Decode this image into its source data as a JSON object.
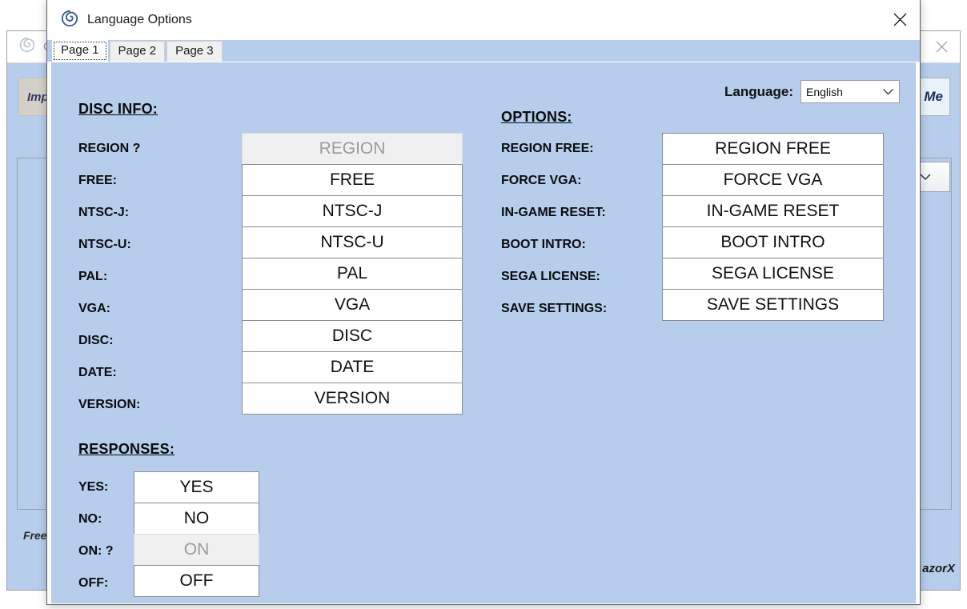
{
  "background_window": {
    "title": "G",
    "icon": "dreamcast-spiral-icon",
    "close_label": "✕",
    "import_button": "Imp",
    "me_button": "Me",
    "combo_chevron": "⌄",
    "footer_left": "Free",
    "footer_right": "azorX"
  },
  "dialog": {
    "title": "Language Options",
    "icon": "dreamcast-spiral-icon",
    "close_label": "✕",
    "tabs": [
      {
        "label": "Page 1",
        "active": true
      },
      {
        "label": "Page 2",
        "active": false
      },
      {
        "label": "Page 3",
        "active": false
      }
    ],
    "language": {
      "label": "Language:",
      "value": "English",
      "chevron": "⌄",
      "options": [
        "English"
      ]
    },
    "sections": {
      "disc_info": {
        "heading": "DISC INFO:",
        "rows": [
          {
            "label": "REGION ?",
            "value": "REGION",
            "disabled": true
          },
          {
            "label": "FREE:",
            "value": "FREE",
            "disabled": false
          },
          {
            "label": "NTSC-J:",
            "value": "NTSC-J",
            "disabled": false
          },
          {
            "label": "NTSC-U:",
            "value": "NTSC-U",
            "disabled": false
          },
          {
            "label": "PAL:",
            "value": "PAL",
            "disabled": false
          },
          {
            "label": "VGA:",
            "value": "VGA",
            "disabled": false
          },
          {
            "label": "DISC:",
            "value": "DISC",
            "disabled": false
          },
          {
            "label": "DATE:",
            "value": "DATE",
            "disabled": false
          },
          {
            "label": "VERSION:",
            "value": "VERSION",
            "disabled": false
          }
        ]
      },
      "options": {
        "heading": "OPTIONS:",
        "rows": [
          {
            "label": "REGION FREE:",
            "value": "REGION FREE",
            "disabled": false
          },
          {
            "label": "FORCE VGA:",
            "value": "FORCE VGA",
            "disabled": false
          },
          {
            "label": "IN-GAME RESET:",
            "value": "IN-GAME RESET",
            "disabled": false
          },
          {
            "label": "BOOT INTRO:",
            "value": "BOOT INTRO",
            "disabled": false
          },
          {
            "label": "SEGA LICENSE:",
            "value": "SEGA LICENSE",
            "disabled": false
          },
          {
            "label": "SAVE SETTINGS:",
            "value": "SAVE SETTINGS",
            "disabled": false
          }
        ]
      },
      "responses": {
        "heading": "RESPONSES:",
        "rows": [
          {
            "label": "YES:",
            "value": "YES",
            "disabled": false
          },
          {
            "label": "NO:",
            "value": "NO",
            "disabled": false
          },
          {
            "label": "ON: ?",
            "value": "ON",
            "disabled": true
          },
          {
            "label": "OFF:",
            "value": "OFF",
            "disabled": false
          }
        ]
      }
    }
  },
  "colors": {
    "body_blue": "#b6cdeb",
    "field_white": "#ffffff",
    "field_disabled": "#f0f0f0",
    "disabled_text": "#9b9b9b",
    "border_gray": "#8d8d8d",
    "spiral_blue": "#3b5a9d"
  }
}
